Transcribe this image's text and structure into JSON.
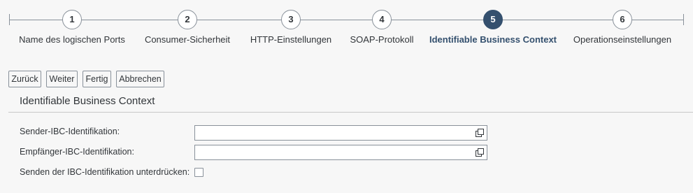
{
  "wizard": {
    "steps": [
      {
        "number": "1",
        "label": "Name des logischen Ports",
        "active": false
      },
      {
        "number": "2",
        "label": "Consumer-Sicherheit",
        "active": false
      },
      {
        "number": "3",
        "label": "HTTP-Einstellungen",
        "active": false
      },
      {
        "number": "4",
        "label": "SOAP-Protokoll",
        "active": false
      },
      {
        "number": "5",
        "label": "Identifiable Business Context",
        "active": true
      },
      {
        "number": "6",
        "label": "Operationseinstellungen",
        "active": false
      }
    ]
  },
  "toolbar": {
    "back_label": "Zurück",
    "next_label": "Weiter",
    "finish_label": "Fertig",
    "cancel_label": "Abbrechen"
  },
  "section": {
    "title": "Identifiable Business Context",
    "fields": {
      "sender_ibc_label": "Sender-IBC-Identifikation:",
      "sender_ibc_value": "",
      "receiver_ibc_label": "Empfänger-IBC-Identifikation:",
      "receiver_ibc_value": "",
      "suppress_ibc_label": "Senden der IBC-Identifikation unterdrücken:",
      "suppress_ibc_checked": false
    }
  },
  "colors": {
    "active_step": "#34506e",
    "background": "#f7f7f7",
    "border": "#89919a"
  },
  "icons": {
    "value_help": "value-help-icon"
  }
}
